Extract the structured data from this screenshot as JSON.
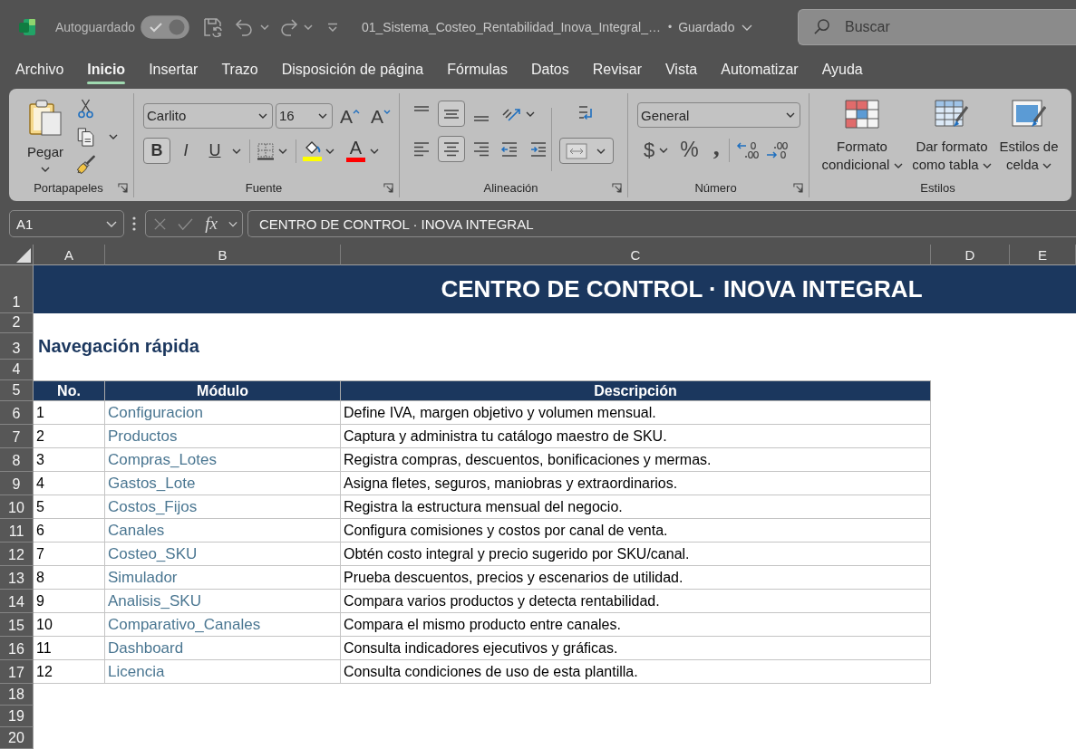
{
  "title_bar": {
    "autosave": {
      "label": "Autoguardado",
      "on": true,
      "disabled": true
    },
    "file_name": "01_Sistema_Costeo_Rentabilidad_Inova_Integral_…",
    "separator": "•",
    "save_status": "Guardado",
    "search": {
      "placeholder": "Buscar"
    }
  },
  "menu_tabs": [
    {
      "label": "Archivo",
      "selected": false
    },
    {
      "label": "Inicio",
      "selected": true
    },
    {
      "label": "Insertar",
      "selected": false
    },
    {
      "label": "Trazo",
      "selected": false
    },
    {
      "label": "Disposición de página",
      "selected": false
    },
    {
      "label": "Fórmulas",
      "selected": false
    },
    {
      "label": "Datos",
      "selected": false
    },
    {
      "label": "Revisar",
      "selected": false
    },
    {
      "label": "Vista",
      "selected": false
    },
    {
      "label": "Automatizar",
      "selected": false
    },
    {
      "label": "Ayuda",
      "selected": false
    }
  ],
  "ribbon": {
    "clipboard": {
      "label": "Portapapeles",
      "paste": "Pegar"
    },
    "font": {
      "label": "Fuente",
      "name": "Carlito",
      "size": "16",
      "grow_glyph": "A",
      "shrink_glyph": "A",
      "styles": [
        {
          "kind": "bold",
          "glyph": "B",
          "on": true
        },
        {
          "kind": "italic",
          "glyph": "I",
          "on": false
        },
        {
          "kind": "underline",
          "glyph": "U",
          "on": false
        }
      ],
      "fill": {
        "color": "#ffff00"
      },
      "font_color": {
        "glyph": "A",
        "color": "#ff0000"
      }
    },
    "alignment": {
      "label": "Alineación",
      "vertical": [
        {
          "kind": "top",
          "selected": false
        },
        {
          "kind": "middle",
          "selected": true
        },
        {
          "kind": "bottom",
          "selected": false
        }
      ],
      "horizontal": [
        {
          "kind": "left",
          "selected": false
        },
        {
          "kind": "center",
          "selected": true
        },
        {
          "kind": "right",
          "selected": false
        }
      ],
      "merged": true
    },
    "number": {
      "label": "Número",
      "format": "General",
      "currency_glyph": "$",
      "percent_glyph": "%",
      "comma_glyph": ","
    },
    "styles": {
      "label": "Estilos",
      "buttons": [
        {
          "kind": "conditional",
          "label": "Formato condicional"
        },
        {
          "kind": "table",
          "label": "Dar formato como tabla"
        },
        {
          "kind": "cell",
          "label": "Estilos de celda"
        }
      ]
    }
  },
  "formula_bar": {
    "name_box": "A1",
    "function_glyph": "fx",
    "formula": "CENTRO DE CONTROL · INOVA INTEGRAL"
  },
  "sheet": {
    "columns": [
      "A",
      "B",
      "C",
      "D",
      "E"
    ],
    "row_numbers": [
      "1",
      "2",
      "3",
      "4",
      "5",
      "6",
      "7",
      "8",
      "9",
      "10",
      "11",
      "12",
      "13",
      "14",
      "15",
      "16",
      "17",
      "18",
      "19",
      "20"
    ],
    "title": "CENTRO DE CONTROL · INOVA INTEGRAL",
    "section_heading": "Navegación rápida",
    "table": {
      "columns": [
        "No.",
        "Módulo",
        "Descripción"
      ],
      "rows": [
        {
          "no": "1",
          "module": "Configuracion",
          "description": "Define IVA, margen objetivo y volumen mensual."
        },
        {
          "no": "2",
          "module": "Productos",
          "description": "Captura y administra tu catálogo maestro de SKU."
        },
        {
          "no": "3",
          "module": "Compras_Lotes",
          "description": "Registra compras, descuentos, bonificaciones y mermas."
        },
        {
          "no": "4",
          "module": "Gastos_Lote",
          "description": "Asigna fletes, seguros, maniobras y extraordinarios."
        },
        {
          "no": "5",
          "module": "Costos_Fijos",
          "description": "Registra la estructura mensual del negocio."
        },
        {
          "no": "6",
          "module": "Canales",
          "description": "Configura comisiones y costos por canal de venta."
        },
        {
          "no": "7",
          "module": "Costeo_SKU",
          "description": "Obtén costo integral y precio sugerido por SKU/canal."
        },
        {
          "no": "8",
          "module": "Simulador",
          "description": "Prueba descuentos, precios y escenarios de utilidad."
        },
        {
          "no": "9",
          "module": "Analisis_SKU",
          "description": "Compara varios productos y detecta rentabilidad."
        },
        {
          "no": "10",
          "module": "Comparativo_Canales",
          "description": "Compara el mismo producto entre canales."
        },
        {
          "no": "11",
          "module": "Dashboard",
          "description": "Consulta indicadores ejecutivos y gráficas."
        },
        {
          "no": "12",
          "module": "Licencia",
          "description": "Consulta condiciones de uso de esta plantilla."
        }
      ]
    }
  }
}
